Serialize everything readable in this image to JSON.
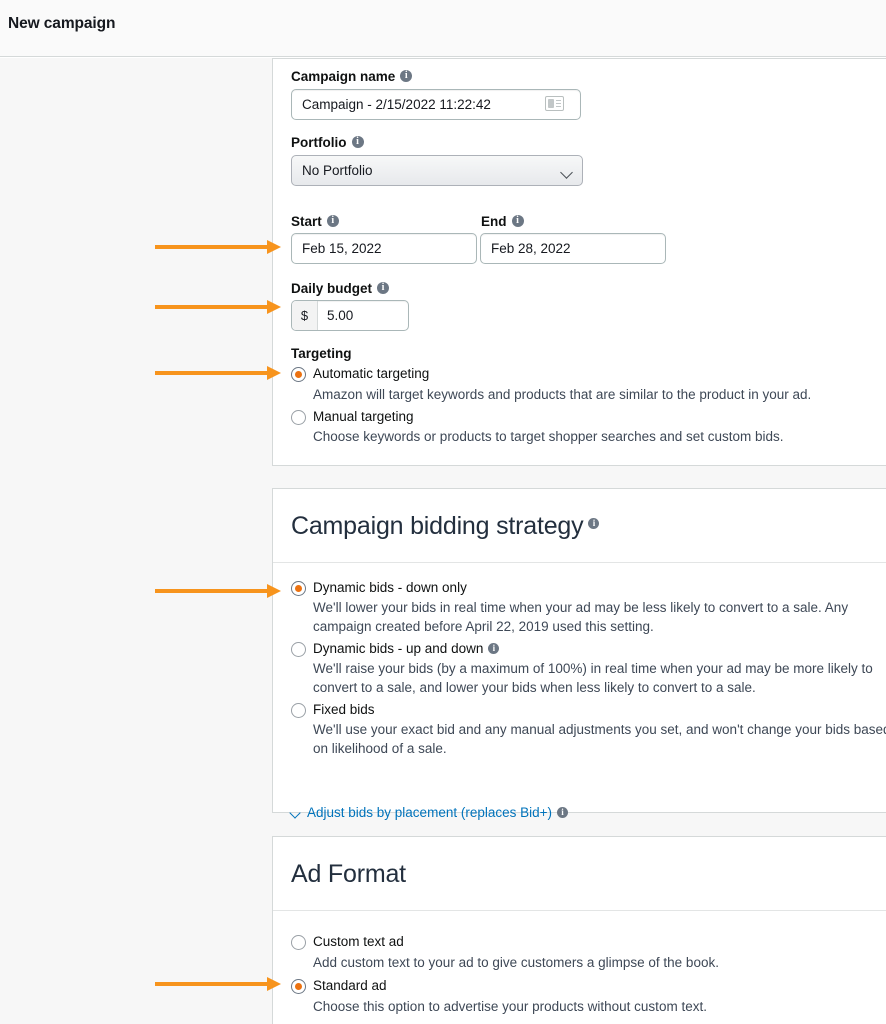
{
  "header": {
    "title": "New campaign"
  },
  "colors": {
    "accent_orange": "#ec7211",
    "arrow_orange": "#f7941d",
    "link_blue": "#0073bb",
    "panel_bg": "#ffffff",
    "page_bg": "#f7f7f7"
  },
  "settings_panel": {
    "campaign_name": {
      "label": "Campaign name",
      "value": "Campaign - 2/15/2022 11:22:42",
      "icon": "contact-card-icon"
    },
    "portfolio": {
      "label": "Portfolio",
      "value": "No Portfolio",
      "icon": "chevron-down-icon"
    },
    "start": {
      "label": "Start",
      "value": "Feb 15, 2022"
    },
    "end": {
      "label": "End",
      "value": "Feb 28, 2022"
    },
    "daily_budget": {
      "label": "Daily budget",
      "currency": "$",
      "value": "5.00"
    },
    "targeting": {
      "label": "Targeting",
      "options": [
        {
          "label": "Automatic targeting",
          "description": "Amazon will target keywords and products that are similar to the product in your ad.",
          "selected": true
        },
        {
          "label": "Manual targeting",
          "description": "Choose keywords or products to target shopper searches and set custom bids.",
          "selected": false
        }
      ]
    }
  },
  "bidding_panel": {
    "title": "Campaign bidding strategy",
    "options": [
      {
        "label": "Dynamic bids - down only",
        "description": "We'll lower your bids in real time when your ad may be less likely to convert to a sale. Any campaign created before April 22, 2019 used this setting.",
        "selected": true,
        "has_info": false
      },
      {
        "label": "Dynamic bids - up and down",
        "description": "We'll raise your bids (by a maximum of 100%) in real time when your ad may be more likely to convert to a sale, and lower your bids when less likely to convert to a sale.",
        "selected": false,
        "has_info": true
      },
      {
        "label": "Fixed bids",
        "description": "We'll use your exact bid and any manual adjustments you set, and won't change your bids based on likelihood of a sale.",
        "selected": false,
        "has_info": false
      }
    ],
    "adjust_link": "Adjust bids by placement (replaces Bid+)"
  },
  "adformat_panel": {
    "title": "Ad Format",
    "options": [
      {
        "label": "Custom text ad",
        "description": "Add custom text to your ad to give customers a glimpse of the book.",
        "selected": false
      },
      {
        "label": "Standard ad",
        "description": "Choose this option to advertise your products without custom text.",
        "selected": true
      }
    ]
  },
  "annotations": {
    "arrows": [
      {
        "target": "start-date-field"
      },
      {
        "target": "daily-budget-field"
      },
      {
        "target": "automatic-targeting-radio"
      },
      {
        "target": "dynamic-bids-down-only-radio"
      },
      {
        "target": "standard-ad-radio"
      }
    ]
  }
}
